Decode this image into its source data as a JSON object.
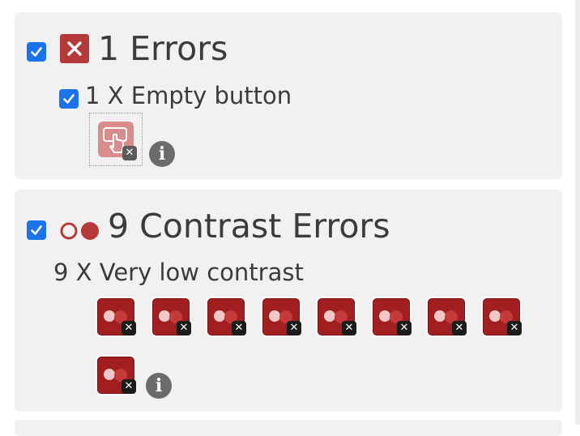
{
  "errors_section": {
    "title": "1 Errors",
    "checked": true,
    "icon": "error-x-icon",
    "items": [
      {
        "label": "1 X Empty button",
        "checked": true,
        "count": 1,
        "thumbnail_icon": "pointer-hand-icon",
        "info_glyph": "i"
      }
    ]
  },
  "contrast_section": {
    "title": "9 Contrast Errors",
    "checked": true,
    "icon": "contrast-dots-icon",
    "items": [
      {
        "label": "9 X Very low contrast",
        "count": 9,
        "info_glyph": "i"
      }
    ]
  },
  "badge_glyph": "✕",
  "colors": {
    "accent_checkbox": "#1a73e8",
    "error_red": "#b73a3a",
    "contrast_red": "#a11f1f",
    "panel_bg": "#f1f1f1"
  }
}
